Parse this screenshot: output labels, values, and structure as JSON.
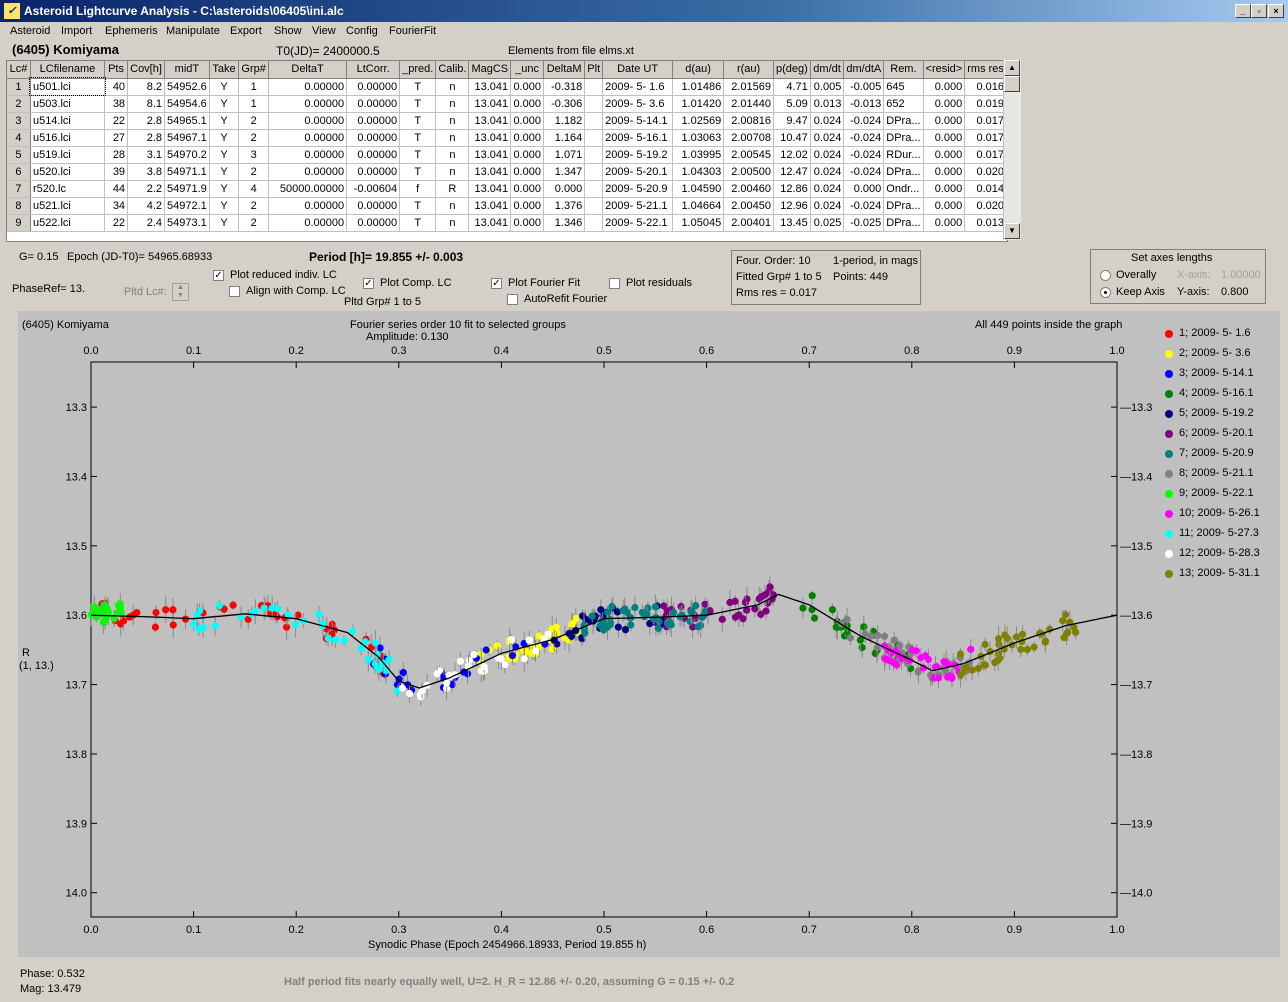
{
  "window": {
    "title": "Asteroid Lightcurve Analysis - C:\\asteroids\\06405\\ini.alc",
    "icon": "app-logo-icon"
  },
  "menu": [
    "Asteroid",
    "Import",
    "Ephemeris",
    "Manipulate",
    "Export",
    "Show",
    "View",
    "Config",
    "FourierFit"
  ],
  "header": {
    "asteroid": "(6405) Komiyama",
    "t0": "T0(JD)= 2400000.5",
    "elements": "Elements from file elms.xt"
  },
  "table": {
    "columns": [
      "Lc#",
      "LCfilename",
      "Pts",
      "Cov[h]",
      "midT",
      "Take",
      "Grp#",
      "DeltaT",
      "LtCorr.",
      "_pred.",
      "Calib.",
      "MagCS",
      "_unc",
      "DeltaM",
      "Plt",
      "Date UT",
      "d(au)",
      "r(au)",
      "p(deg)",
      "dm/dt",
      "dm/dtA",
      "Rem.",
      "<resid>",
      "rms res"
    ],
    "rows": [
      [
        "1",
        "u501.lci",
        "40",
        "8.2",
        "54952.6",
        "Y",
        "1",
        "0.00000",
        "0.00000",
        "T",
        "n",
        "13.041",
        "0.000",
        "-0.318",
        "",
        "2009- 5- 1.6",
        "1.01486",
        "2.01569",
        "4.71",
        "0.005",
        "-0.005",
        "645",
        "0.000",
        "0.016"
      ],
      [
        "2",
        "u503.lci",
        "38",
        "8.1",
        "54954.6",
        "Y",
        "1",
        "0.00000",
        "0.00000",
        "T",
        "n",
        "13.041",
        "0.000",
        "-0.306",
        "",
        "2009- 5- 3.6",
        "1.01420",
        "2.01440",
        "5.09",
        "0.013",
        "-0.013",
        "652",
        "0.000",
        "0.019"
      ],
      [
        "3",
        "u514.lci",
        "22",
        "2.8",
        "54965.1",
        "Y",
        "2",
        "0.00000",
        "0.00000",
        "T",
        "n",
        "13.041",
        "0.000",
        "1.182",
        "",
        "2009- 5-14.1",
        "1.02569",
        "2.00816",
        "9.47",
        "0.024",
        "-0.024",
        "DPra...",
        "0.000",
        "0.017"
      ],
      [
        "4",
        "u516.lci",
        "27",
        "2.8",
        "54967.1",
        "Y",
        "2",
        "0.00000",
        "0.00000",
        "T",
        "n",
        "13.041",
        "0.000",
        "1.164",
        "",
        "2009- 5-16.1",
        "1.03063",
        "2.00708",
        "10.47",
        "0.024",
        "-0.024",
        "DPra...",
        "0.000",
        "0.017"
      ],
      [
        "5",
        "u519.lci",
        "28",
        "3.1",
        "54970.2",
        "Y",
        "3",
        "0.00000",
        "0.00000",
        "T",
        "n",
        "13.041",
        "0.000",
        "1.071",
        "",
        "2009- 5-19.2",
        "1.03995",
        "2.00545",
        "12.02",
        "0.024",
        "-0.024",
        "RDur...",
        "0.000",
        "0.017"
      ],
      [
        "6",
        "u520.lci",
        "39",
        "3.8",
        "54971.1",
        "Y",
        "2",
        "0.00000",
        "0.00000",
        "T",
        "n",
        "13.041",
        "0.000",
        "1.347",
        "",
        "2009- 5-20.1",
        "1.04303",
        "2.00500",
        "12.47",
        "0.024",
        "-0.024",
        "DPra...",
        "0.000",
        "0.020"
      ],
      [
        "7",
        "r520.lc",
        "44",
        "2.2",
        "54971.9",
        "Y",
        "4",
        "50000.00000",
        "-0.00604",
        "f",
        "R",
        "13.041",
        "0.000",
        "0.000",
        "",
        "2009- 5-20.9",
        "1.04590",
        "2.00460",
        "12.86",
        "0.024",
        "0.000",
        "Ondr...",
        "0.000",
        "0.014"
      ],
      [
        "8",
        "u521.lci",
        "34",
        "4.2",
        "54972.1",
        "Y",
        "2",
        "0.00000",
        "0.00000",
        "T",
        "n",
        "13.041",
        "0.000",
        "1.376",
        "",
        "2009- 5-21.1",
        "1.04664",
        "2.00450",
        "12.96",
        "0.024",
        "-0.024",
        "DPra...",
        "0.000",
        "0.020"
      ],
      [
        "9",
        "u522.lci",
        "22",
        "2.4",
        "54973.1",
        "Y",
        "2",
        "0.00000",
        "0.00000",
        "T",
        "n",
        "13.041",
        "0.000",
        "1.346",
        "",
        "2009- 5-22.1",
        "1.05045",
        "2.00401",
        "13.45",
        "0.025",
        "-0.025",
        "DPra...",
        "0.000",
        "0.013"
      ]
    ]
  },
  "controls": {
    "g": "G= 0.15",
    "epoch": "Epoch (JD-T0)= 54965.68933",
    "period": "Period [h]= 19.855 +/- 0.003",
    "phaseref": "PhaseRef= 13.",
    "pltd_lc": "Pltd Lc#:",
    "pltd_grp": "Pltd Grp#  1   to   5",
    "plot_reduced": "Plot reduced indiv. LC",
    "align": "Align with Comp. LC",
    "plot_comp": "Plot Comp. LC",
    "plot_fourier": "Plot Fourier Fit",
    "autorefit": "AutoRefit Fourier",
    "plot_resid": "Plot residuals",
    "check_states": {
      "plot_reduced": true,
      "align": false,
      "plot_comp": true,
      "plot_fourier": true,
      "autorefit": false,
      "plot_resid": false
    }
  },
  "fourier_info": {
    "order": "Four. Order: 10",
    "period_mode": "1-period, in mags",
    "fitted": "Fitted Grp# 1 to 5",
    "points": "Points: 449",
    "rms": "Rms res      = 0.017"
  },
  "axes_box": {
    "title": "Set axes lengths",
    "overally": "Overally",
    "keep": "Keep Axis",
    "xaxis_label": "X-axis:",
    "xaxis_val": "1.00000",
    "yaxis_label": "Y-axis:",
    "yaxis_val": "0.800",
    "selected": "keep"
  },
  "plot": {
    "name": "(6405) Komiyama",
    "fourier_title": "Fourier series order 10 fit to selected groups",
    "amplitude": "Amplitude: 0.130",
    "points_note": "All 449 points inside the graph",
    "ylabel_1": "R",
    "ylabel_2": "(1, 13.)",
    "xlabel": "Synodic Phase (Epoch 2454966.18933, Period 19.855 h)"
  },
  "chart_data": {
    "type": "scatter",
    "x_ticks": [
      "0.0",
      "0.1",
      "0.2",
      "0.3",
      "0.4",
      "0.5",
      "0.6",
      "0.7",
      "0.8",
      "0.9",
      "1.0"
    ],
    "y_ticks": [
      "13.3",
      "13.4",
      "13.5",
      "13.6",
      "13.7",
      "13.8",
      "13.9",
      "14.0"
    ],
    "xlim": [
      0.0,
      1.0
    ],
    "ylim": [
      13.235,
      14.035
    ],
    "y_inverted": true,
    "fit_curve": {
      "x": [
        0.0,
        0.05,
        0.1,
        0.15,
        0.2,
        0.25,
        0.28,
        0.3,
        0.32,
        0.35,
        0.4,
        0.45,
        0.5,
        0.55,
        0.6,
        0.65,
        0.67,
        0.7,
        0.75,
        0.8,
        0.82,
        0.85,
        0.9,
        0.95,
        1.0
      ],
      "y": [
        13.6,
        13.602,
        13.605,
        13.598,
        13.605,
        13.625,
        13.66,
        13.695,
        13.705,
        13.69,
        13.655,
        13.635,
        13.605,
        13.603,
        13.6,
        13.585,
        13.57,
        13.585,
        13.63,
        13.665,
        13.68,
        13.67,
        13.64,
        13.615,
        13.6
      ]
    },
    "series": [
      {
        "name": "1; 2009- 5- 1.6",
        "color": "#ff0000",
        "x_range": [
          0.0,
          0.3
        ],
        "y_center": 13.61,
        "n": 40
      },
      {
        "name": "2; 2009- 5- 3.6",
        "color": "#ffff00",
        "x_range": [
          0.38,
          0.48
        ],
        "y_center": 13.64,
        "n": 38
      },
      {
        "name": "3; 2009- 5-14.1",
        "color": "#0000ff",
        "x_range": [
          0.27,
          0.45
        ],
        "y_center": 13.67,
        "n": 22
      },
      {
        "name": "4; 2009- 5-16.1",
        "color": "#008000",
        "x_range": [
          0.69,
          0.8
        ],
        "y_center": 13.62,
        "n": 27
      },
      {
        "name": "5; 2009- 5-19.2",
        "color": "#000080",
        "x_range": [
          0.45,
          0.56
        ],
        "y_center": 13.6,
        "n": 28
      },
      {
        "name": "6; 2009- 5-20.1",
        "color": "#800080",
        "x_range": [
          0.55,
          0.67
        ],
        "y_center": 13.6,
        "n": 39
      },
      {
        "name": "7; 2009- 5-20.9",
        "color": "#008080",
        "x_range": [
          0.48,
          0.6
        ],
        "y_center": 13.6,
        "n": 44
      },
      {
        "name": "8; 2009- 5-21.1",
        "color": "#808080",
        "x_range": [
          0.73,
          0.86
        ],
        "y_center": 13.66,
        "n": 34
      },
      {
        "name": "9; 2009- 5-22.1",
        "color": "#00ff00",
        "x_range": [
          0.0,
          0.03
        ],
        "y_center": 13.6,
        "n": 22
      },
      {
        "name": "10; 2009- 5-26.1",
        "color": "#ff00ff",
        "x_range": [
          0.77,
          0.86
        ],
        "y_center": 13.67,
        "n": 30
      },
      {
        "name": "11; 2009- 5-27.3",
        "color": "#00ffff",
        "x_range": [
          0.1,
          0.3
        ],
        "y_center": 13.63,
        "n": 35
      },
      {
        "name": "12; 2009- 5-28.3",
        "color": "#ffffff",
        "x_range": [
          0.3,
          0.45
        ],
        "y_center": 13.68,
        "n": 30
      },
      {
        "name": "13; 2009- 5-31.1",
        "color": "#808000",
        "x_range": [
          0.84,
          0.97
        ],
        "y_center": 13.64,
        "n": 40
      }
    ]
  },
  "status": {
    "phase": "Phase:  0.532",
    "mag": "Mag:   13.479",
    "note": "Half period fits nearly equally well, U=2.  H_R = 12.86 +/- 0.20, assuming G = 0.15 +/- 0.2"
  }
}
